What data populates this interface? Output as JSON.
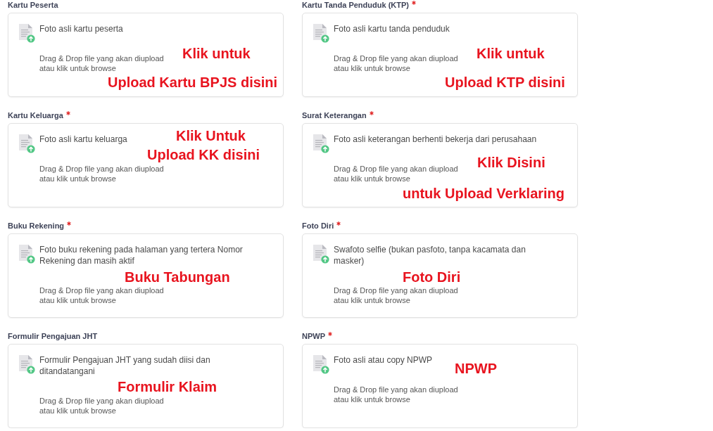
{
  "fields": [
    {
      "label": "Kartu Peserta",
      "required": false,
      "description": "Foto asli kartu peserta",
      "hint_lines": [
        "Drag & Drop file yang akan diupload",
        "atau klik untuk browse"
      ],
      "annotations": [
        "Klik untuk",
        "Upload Kartu BPJS disini"
      ]
    },
    {
      "label": "Kartu Tanda Penduduk (KTP)",
      "required": true,
      "description": "Foto asli kartu tanda penduduk",
      "hint_lines": [
        "Drag & Drop file yang akan diupload",
        "atau klik untuk browse"
      ],
      "annotations": [
        "Klik untuk",
        "Upload KTP disini"
      ]
    },
    {
      "label": "Kartu Keluarga",
      "required": true,
      "description": "Foto asli kartu keluarga",
      "hint_lines": [
        "Drag & Drop file yang akan diupload",
        "atau klik untuk browse"
      ],
      "annotations": [
        "Klik Untuk",
        "Upload KK disini"
      ]
    },
    {
      "label": "Surat Keterangan",
      "required": true,
      "description": "Foto asli keterangan berhenti bekerja dari perusahaan",
      "hint_lines": [
        "Drag & Drop file yang akan diupload",
        "atau klik untuk browse"
      ],
      "annotations": [
        "Klik Disini",
        "untuk Upload Verklaring"
      ]
    },
    {
      "label": "Buku Rekening",
      "required": true,
      "description": "Foto buku rekening pada halaman yang tertera Nomor Rekening dan masih aktif",
      "hint_lines": [
        "Drag & Drop file yang akan diupload",
        "atau klik untuk browse"
      ],
      "annotations": [
        "Buku Tabungan"
      ]
    },
    {
      "label": "Foto Diri",
      "required": true,
      "description": "Swafoto selfie (bukan pasfoto, tanpa kacamata dan masker)",
      "hint_lines": [
        "Drag & Drop file yang akan diupload",
        "atau klik untuk browse"
      ],
      "annotations": [
        "Foto Diri"
      ]
    },
    {
      "label": "Formulir Pengajuan JHT",
      "required": false,
      "description": "Formulir Pengajuan JHT yang sudah diisi dan ditandatangani",
      "hint_lines": [
        "Drag & Drop file yang akan diupload",
        "atau klik untuk browse"
      ],
      "annotations": [
        "Formulir Klaim"
      ]
    },
    {
      "label": "NPWP",
      "required": true,
      "description": "Foto asli atau copy NPWP",
      "hint_lines": [
        "Drag & Drop file yang akan diupload",
        "atau klik untuk browse"
      ],
      "annotations": [
        "NPWP"
      ]
    }
  ]
}
